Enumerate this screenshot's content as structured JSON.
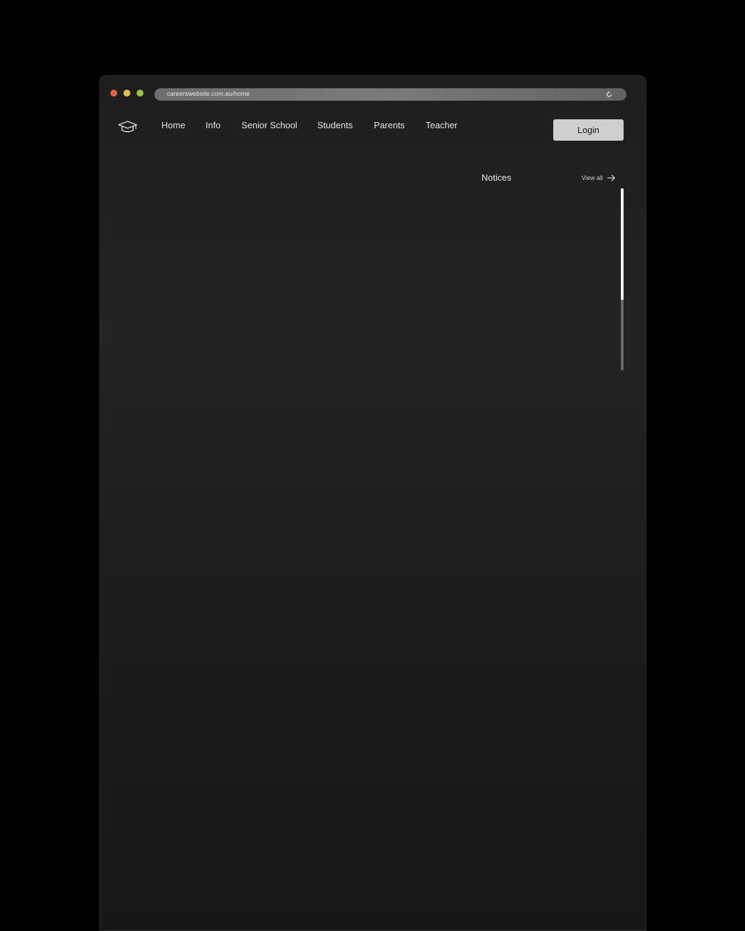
{
  "browser": {
    "url": "careerswebsite.com.au/home",
    "controls": [
      "close",
      "minimize",
      "maximize"
    ],
    "reload_icon": "reload-icon"
  },
  "nav": {
    "logo_icon": "graduation-cap-icon",
    "items": [
      "Home",
      "Info",
      "Senior School",
      "Students",
      "Parents",
      "Teacher"
    ],
    "login_label": "Login"
  },
  "notices": {
    "title": "Notices",
    "view_all_label": "View all",
    "view_all_icon": "arrow-right-icon",
    "scroll_position": 0
  },
  "colors": {
    "background": "#000000",
    "window": "#1e1e1e",
    "login_button": "#cfcfcf",
    "close": "#e2603f",
    "minimize": "#e6c14a",
    "maximize": "#9dc43a"
  }
}
